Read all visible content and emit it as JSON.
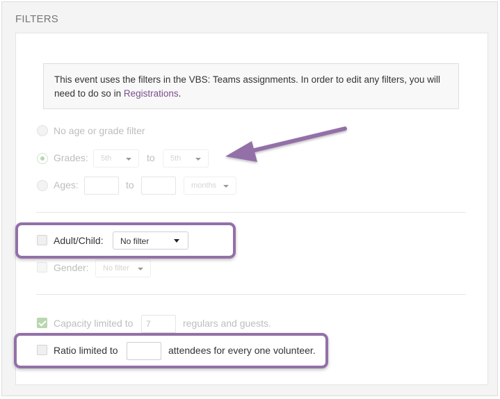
{
  "section_title": "FILTERS",
  "notice": {
    "text_before": "This event uses the filters in the VBS: Teams assignments. In order to edit any filters, you will need to do so in ",
    "link_label": "Registrations",
    "text_after": "."
  },
  "age_filters": {
    "none_label": "No age or grade filter",
    "grades_label": "Grades:",
    "grade_from": "5th",
    "to_label_1": "to",
    "grade_to": "5th",
    "ages_label": "Ages:",
    "age_from": "",
    "to_label_2": "to",
    "age_to": "",
    "age_unit": "months",
    "selected": "grades"
  },
  "adult_child": {
    "label": "Adult/Child:",
    "value": "No filter",
    "checked": false
  },
  "gender": {
    "label": "Gender:",
    "value": "No filter",
    "checked": false
  },
  "capacity": {
    "label": "Capacity limited to",
    "value": "7",
    "suffix": "regulars and guests.",
    "checked": true
  },
  "ratio": {
    "label": "Ratio limited to",
    "value": "",
    "suffix": "attendees for every one volunteer.",
    "checked": false
  },
  "colors": {
    "highlight": "#9370a8",
    "link": "#7b4f8f",
    "check_green": "#b9d7b0"
  }
}
